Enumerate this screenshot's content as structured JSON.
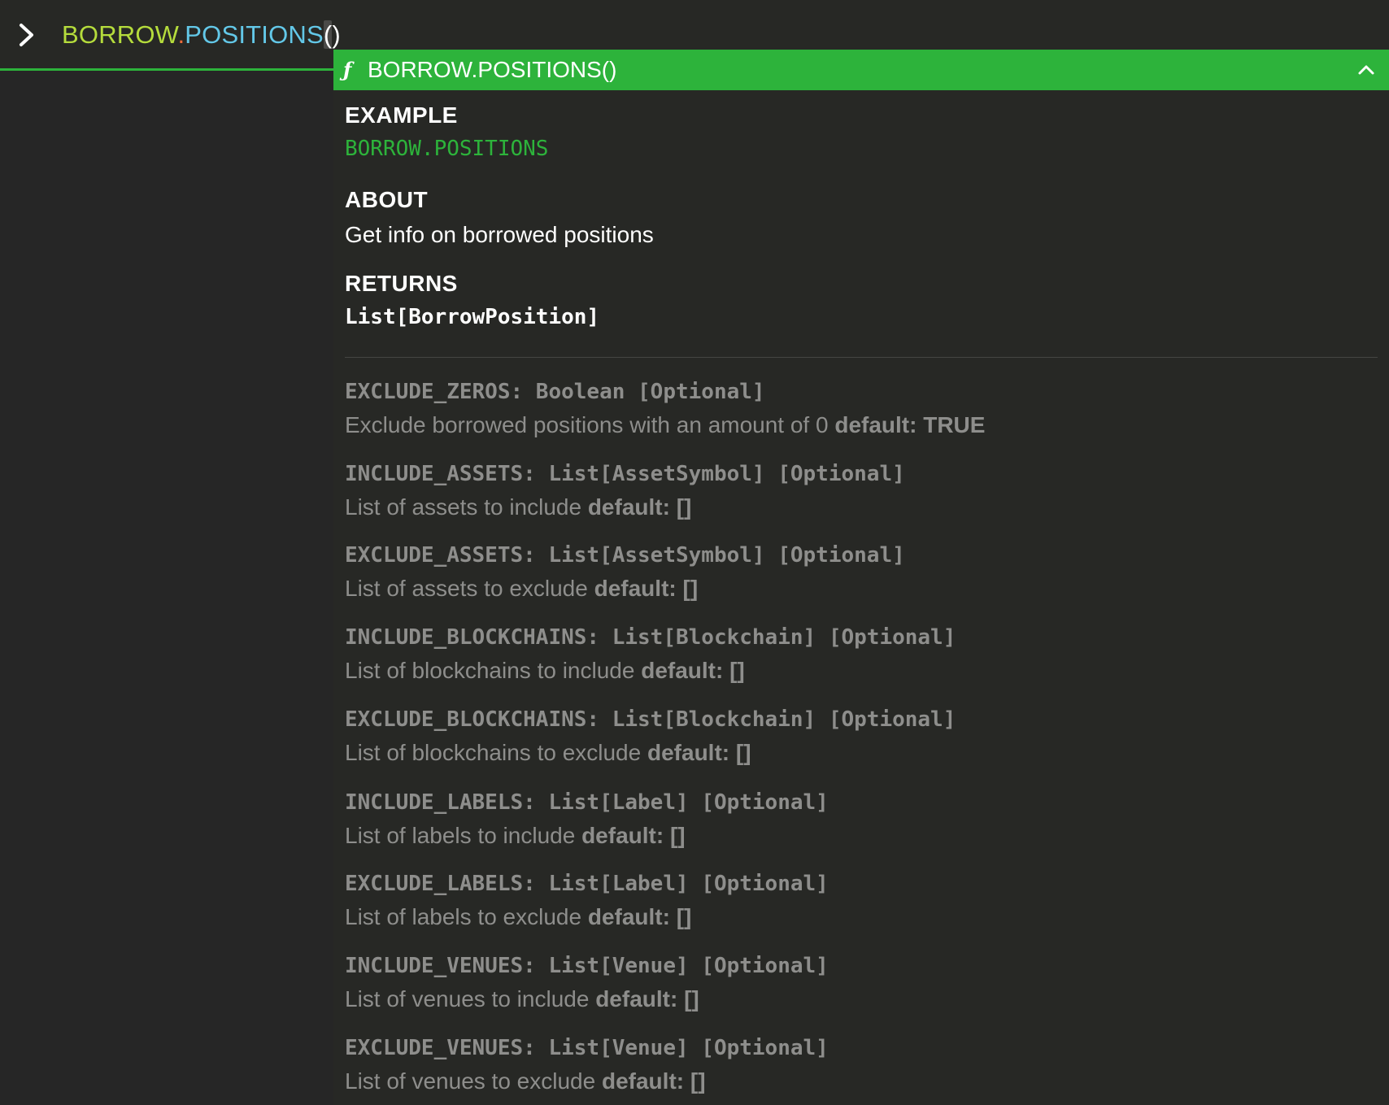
{
  "prompt": {
    "namespace": "BORROW",
    "dot": ".",
    "function": "POSITIONS",
    "paren_open": "(",
    "paren_close": ")"
  },
  "doc": {
    "title": "BORROW.POSITIONS()",
    "fn_icon": "ƒ",
    "example_heading": "EXAMPLE",
    "example_code": "BORROW.POSITIONS",
    "about_heading": "ABOUT",
    "about_text": "Get info on borrowed positions",
    "returns_heading": "RETURNS",
    "returns_type": "List[BorrowPosition]",
    "params": [
      {
        "signature": "EXCLUDE_ZEROS: Boolean [Optional]",
        "description": "Exclude borrowed positions with an amount of 0",
        "default": "default: TRUE"
      },
      {
        "signature": "INCLUDE_ASSETS: List[AssetSymbol] [Optional]",
        "description": "List of assets to include",
        "default": "default: []"
      },
      {
        "signature": "EXCLUDE_ASSETS: List[AssetSymbol] [Optional]",
        "description": "List of assets to exclude",
        "default": "default: []"
      },
      {
        "signature": "INCLUDE_BLOCKCHAINS: List[Blockchain] [Optional]",
        "description": "List of blockchains to include",
        "default": "default: []"
      },
      {
        "signature": "EXCLUDE_BLOCKCHAINS: List[Blockchain] [Optional]",
        "description": "List of blockchains to exclude",
        "default": "default: []"
      },
      {
        "signature": "INCLUDE_LABELS: List[Label] [Optional]",
        "description": "List of labels to include",
        "default": "default: []"
      },
      {
        "signature": "EXCLUDE_LABELS: List[Label] [Optional]",
        "description": "List of labels to exclude",
        "default": "default: []"
      },
      {
        "signature": "INCLUDE_VENUES: List[Venue] [Optional]",
        "description": "List of venues to include",
        "default": "default: []"
      },
      {
        "signature": "EXCLUDE_VENUES: List[Venue] [Optional]",
        "description": "List of venues to exclude",
        "default": "default: []"
      }
    ]
  },
  "icons": {
    "prompt": "chevron-right-icon",
    "function": "function-icon",
    "collapse": "chevron-up-icon"
  },
  "colors": {
    "accent": "#2db33b",
    "namespace": "#b5dc3c",
    "dot": "#ee6a3a",
    "function": "#63c8e8",
    "background": "#262626",
    "muted_text": "#8e8e8c"
  }
}
